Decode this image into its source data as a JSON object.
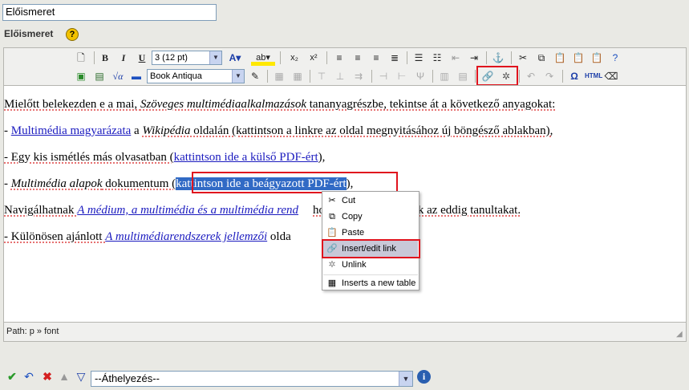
{
  "title_field": {
    "value": "Előismeret"
  },
  "field_label": "Előismeret",
  "help_icon": "?",
  "toolbar": {
    "font_size": "3 (12 pt)",
    "font_family": "Book Antiqua"
  },
  "content": {
    "p1": {
      "a": "Mielőtt belekezden e a mai, ",
      "b": "Szöveges multimédiaalkalmazások",
      "c": " tananyagrészbe, tekintse át a következő anyagokat:"
    },
    "p2": {
      "a": "- ",
      "link": "Multimédia magyarázata",
      "b": " a ",
      "c": "Wikipédia",
      "d": " oldalán (kattintson a linkre az oldal megnyitásához új böngésző ablakban),"
    },
    "p3": {
      "a": "- Egy kis ismétlés más olvasatban (",
      "link": "kattintson ide a külső PDF-ért",
      "b": "),"
    },
    "p4": {
      "a": "- ",
      "b": "Multimédia alapok",
      "c": " dokumentum (",
      "selected": "kattintson ide a beágyazott PDF-ért",
      "d": "),"
    },
    "p5": {
      "a": "Navigálhatnak ",
      "link": "A médium, a multimédia és a multimédia rend",
      "b": "hoz is, hogy felidézzék az eddig tanultakat."
    },
    "p6": {
      "a": "- Különösen ajánlott ",
      "link": "A multimédiarendszerek jellemzői",
      "b": " olda"
    }
  },
  "status_bar": {
    "path": "Path: p » font"
  },
  "context_menu": [
    {
      "label": "Cut",
      "icon": "scissors-icon"
    },
    {
      "label": "Copy",
      "icon": "copy-icon"
    },
    {
      "label": "Paste",
      "icon": "paste-icon"
    },
    {
      "label": "Insert/edit link",
      "icon": "link-icon"
    },
    {
      "label": "Unlink",
      "icon": "unlink-icon"
    },
    {
      "label": "Inserts a new table",
      "icon": "table-icon"
    }
  ],
  "bottom_bar": {
    "move_select": "--Áthelyezés--"
  },
  "colors": {
    "link": "#1b1bbf",
    "selection": "#316ac5",
    "highlight_box": "#e0141e",
    "menu_hover": "#c8c8d8"
  }
}
